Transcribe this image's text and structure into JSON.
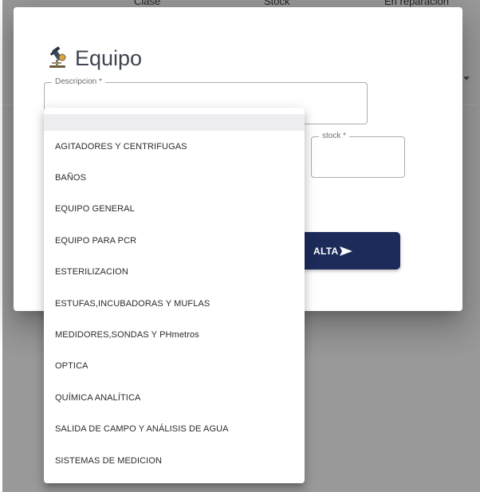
{
  "background": {
    "columns": [
      "Clase",
      "Stock",
      "En reparación"
    ]
  },
  "dialog": {
    "title": "Equipo",
    "icon": "microscope-icon",
    "description_field": {
      "label": "Descripcion *",
      "value": ""
    },
    "stock_field": {
      "label": "stock *",
      "value": ""
    },
    "submit_button": {
      "label": "ALTA",
      "icon": "send-icon"
    }
  },
  "dropdown": {
    "selected_index": 0,
    "options": [
      "",
      "AGITADORES Y CENTRIFUGAS",
      "BAÑOS",
      "EQUIPO GENERAL",
      "EQUIPO PARA PCR",
      "ESTERILIZACION",
      "ESTUFAS,INCUBADORAS Y MUFLAS",
      "MEDIDORES,SONDAS Y PHmetros",
      "OPTICA",
      "QUÍMICA ANALÍTICA",
      "SALIDA DE CAMPO Y ANÁLISIS DE AGUA",
      "SISTEMAS DE MEDICION"
    ]
  },
  "colors": {
    "primary_button": "#1d2b5a",
    "overlay": "rgba(33,33,33,0.46)",
    "title_text": "#3f4550"
  }
}
